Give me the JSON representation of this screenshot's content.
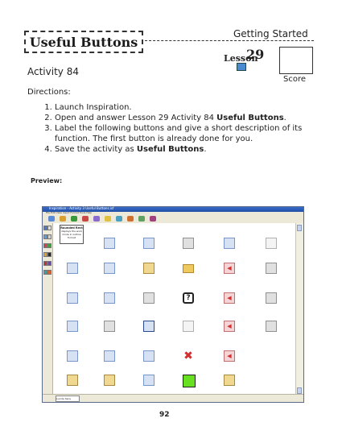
{
  "header": {
    "title": "Useful Buttons",
    "section": "Getting Started",
    "lesson_prefix": "Lesson",
    "lesson_number": "29",
    "score_label": "Score"
  },
  "activity": {
    "label": "Activity 84",
    "directions_label": "Directions:",
    "steps": [
      {
        "text": "Launch Inspiration.",
        "bold": ""
      },
      {
        "text": "Open and answer Lesson 29 Activity 84 ",
        "bold": "Useful Buttons",
        "after": "."
      },
      {
        "text": "Label the following buttons and give a short description of its function. The first button is already done for you.",
        "bold": ""
      },
      {
        "text": "Save the activity as ",
        "bold": "Useful Buttons",
        "after": "."
      }
    ]
  },
  "preview": {
    "label": "Preview:",
    "window_title": "Inspiration - Activity 3 Useful Buttons.isf",
    "menu": "File  Edit  View  Insert  Format  Tools  Help",
    "callout_title": "Rounded Rect",
    "callout_text": "displays the work mode in outline format",
    "font_value": "Lucida Sans Unicode"
  },
  "page_number": "92",
  "colors": {
    "titlebar": "#1f4fa8",
    "red_icon": "#d23030",
    "green_square": "#66e020"
  },
  "icons": [
    "pencil-icon",
    "binoculars-icon",
    "printer-icon",
    "save-disk-icon",
    "spell-check-icon",
    "table-icon",
    "zoom-icon",
    "tools-icon",
    "folder-icon",
    "previous-icon",
    "grid-icon",
    "window-icon",
    "arrange-icon",
    "print-preview-icon",
    "help-icon",
    "back-arrow-icon",
    "slide-icon",
    "panel-icon",
    "document-icon",
    "undo-icon",
    "page-icon",
    "play-icon",
    "columns-icon",
    "magnifier-icon",
    "list-icon",
    "numbering-icon",
    "delete-icon",
    "end-icon",
    "paint-icon",
    "clip-icon",
    "hammer-icon",
    "green-square-icon",
    "outline-list-icon"
  ]
}
